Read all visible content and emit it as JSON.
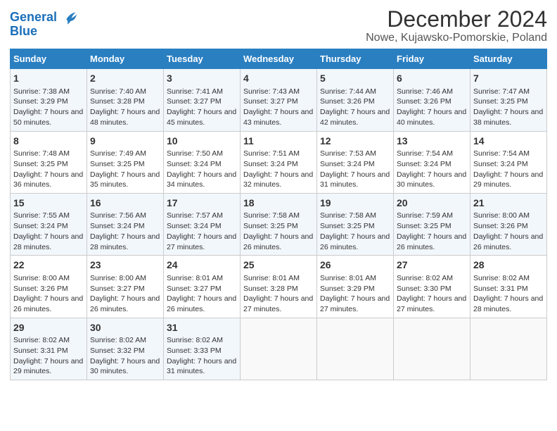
{
  "logo": {
    "line1": "General",
    "line2": "Blue"
  },
  "title": "December 2024",
  "subtitle": "Nowe, Kujawsko-Pomorskie, Poland",
  "days_of_week": [
    "Sunday",
    "Monday",
    "Tuesday",
    "Wednesday",
    "Thursday",
    "Friday",
    "Saturday"
  ],
  "weeks": [
    [
      {
        "day": "1",
        "sunrise": "Sunrise: 7:38 AM",
        "sunset": "Sunset: 3:29 PM",
        "daylight": "Daylight: 7 hours and 50 minutes."
      },
      {
        "day": "2",
        "sunrise": "Sunrise: 7:40 AM",
        "sunset": "Sunset: 3:28 PM",
        "daylight": "Daylight: 7 hours and 48 minutes."
      },
      {
        "day": "3",
        "sunrise": "Sunrise: 7:41 AM",
        "sunset": "Sunset: 3:27 PM",
        "daylight": "Daylight: 7 hours and 45 minutes."
      },
      {
        "day": "4",
        "sunrise": "Sunrise: 7:43 AM",
        "sunset": "Sunset: 3:27 PM",
        "daylight": "Daylight: 7 hours and 43 minutes."
      },
      {
        "day": "5",
        "sunrise": "Sunrise: 7:44 AM",
        "sunset": "Sunset: 3:26 PM",
        "daylight": "Daylight: 7 hours and 42 minutes."
      },
      {
        "day": "6",
        "sunrise": "Sunrise: 7:46 AM",
        "sunset": "Sunset: 3:26 PM",
        "daylight": "Daylight: 7 hours and 40 minutes."
      },
      {
        "day": "7",
        "sunrise": "Sunrise: 7:47 AM",
        "sunset": "Sunset: 3:25 PM",
        "daylight": "Daylight: 7 hours and 38 minutes."
      }
    ],
    [
      {
        "day": "8",
        "sunrise": "Sunrise: 7:48 AM",
        "sunset": "Sunset: 3:25 PM",
        "daylight": "Daylight: 7 hours and 36 minutes."
      },
      {
        "day": "9",
        "sunrise": "Sunrise: 7:49 AM",
        "sunset": "Sunset: 3:25 PM",
        "daylight": "Daylight: 7 hours and 35 minutes."
      },
      {
        "day": "10",
        "sunrise": "Sunrise: 7:50 AM",
        "sunset": "Sunset: 3:24 PM",
        "daylight": "Daylight: 7 hours and 34 minutes."
      },
      {
        "day": "11",
        "sunrise": "Sunrise: 7:51 AM",
        "sunset": "Sunset: 3:24 PM",
        "daylight": "Daylight: 7 hours and 32 minutes."
      },
      {
        "day": "12",
        "sunrise": "Sunrise: 7:53 AM",
        "sunset": "Sunset: 3:24 PM",
        "daylight": "Daylight: 7 hours and 31 minutes."
      },
      {
        "day": "13",
        "sunrise": "Sunrise: 7:54 AM",
        "sunset": "Sunset: 3:24 PM",
        "daylight": "Daylight: 7 hours and 30 minutes."
      },
      {
        "day": "14",
        "sunrise": "Sunrise: 7:54 AM",
        "sunset": "Sunset: 3:24 PM",
        "daylight": "Daylight: 7 hours and 29 minutes."
      }
    ],
    [
      {
        "day": "15",
        "sunrise": "Sunrise: 7:55 AM",
        "sunset": "Sunset: 3:24 PM",
        "daylight": "Daylight: 7 hours and 28 minutes."
      },
      {
        "day": "16",
        "sunrise": "Sunrise: 7:56 AM",
        "sunset": "Sunset: 3:24 PM",
        "daylight": "Daylight: 7 hours and 28 minutes."
      },
      {
        "day": "17",
        "sunrise": "Sunrise: 7:57 AM",
        "sunset": "Sunset: 3:24 PM",
        "daylight": "Daylight: 7 hours and 27 minutes."
      },
      {
        "day": "18",
        "sunrise": "Sunrise: 7:58 AM",
        "sunset": "Sunset: 3:25 PM",
        "daylight": "Daylight: 7 hours and 26 minutes."
      },
      {
        "day": "19",
        "sunrise": "Sunrise: 7:58 AM",
        "sunset": "Sunset: 3:25 PM",
        "daylight": "Daylight: 7 hours and 26 minutes."
      },
      {
        "day": "20",
        "sunrise": "Sunrise: 7:59 AM",
        "sunset": "Sunset: 3:25 PM",
        "daylight": "Daylight: 7 hours and 26 minutes."
      },
      {
        "day": "21",
        "sunrise": "Sunrise: 8:00 AM",
        "sunset": "Sunset: 3:26 PM",
        "daylight": "Daylight: 7 hours and 26 minutes."
      }
    ],
    [
      {
        "day": "22",
        "sunrise": "Sunrise: 8:00 AM",
        "sunset": "Sunset: 3:26 PM",
        "daylight": "Daylight: 7 hours and 26 minutes."
      },
      {
        "day": "23",
        "sunrise": "Sunrise: 8:00 AM",
        "sunset": "Sunset: 3:27 PM",
        "daylight": "Daylight: 7 hours and 26 minutes."
      },
      {
        "day": "24",
        "sunrise": "Sunrise: 8:01 AM",
        "sunset": "Sunset: 3:27 PM",
        "daylight": "Daylight: 7 hours and 26 minutes."
      },
      {
        "day": "25",
        "sunrise": "Sunrise: 8:01 AM",
        "sunset": "Sunset: 3:28 PM",
        "daylight": "Daylight: 7 hours and 27 minutes."
      },
      {
        "day": "26",
        "sunrise": "Sunrise: 8:01 AM",
        "sunset": "Sunset: 3:29 PM",
        "daylight": "Daylight: 7 hours and 27 minutes."
      },
      {
        "day": "27",
        "sunrise": "Sunrise: 8:02 AM",
        "sunset": "Sunset: 3:30 PM",
        "daylight": "Daylight: 7 hours and 27 minutes."
      },
      {
        "day": "28",
        "sunrise": "Sunrise: 8:02 AM",
        "sunset": "Sunset: 3:31 PM",
        "daylight": "Daylight: 7 hours and 28 minutes."
      }
    ],
    [
      {
        "day": "29",
        "sunrise": "Sunrise: 8:02 AM",
        "sunset": "Sunset: 3:31 PM",
        "daylight": "Daylight: 7 hours and 29 minutes."
      },
      {
        "day": "30",
        "sunrise": "Sunrise: 8:02 AM",
        "sunset": "Sunset: 3:32 PM",
        "daylight": "Daylight: 7 hours and 30 minutes."
      },
      {
        "day": "31",
        "sunrise": "Sunrise: 8:02 AM",
        "sunset": "Sunset: 3:33 PM",
        "daylight": "Daylight: 7 hours and 31 minutes."
      },
      null,
      null,
      null,
      null
    ]
  ]
}
